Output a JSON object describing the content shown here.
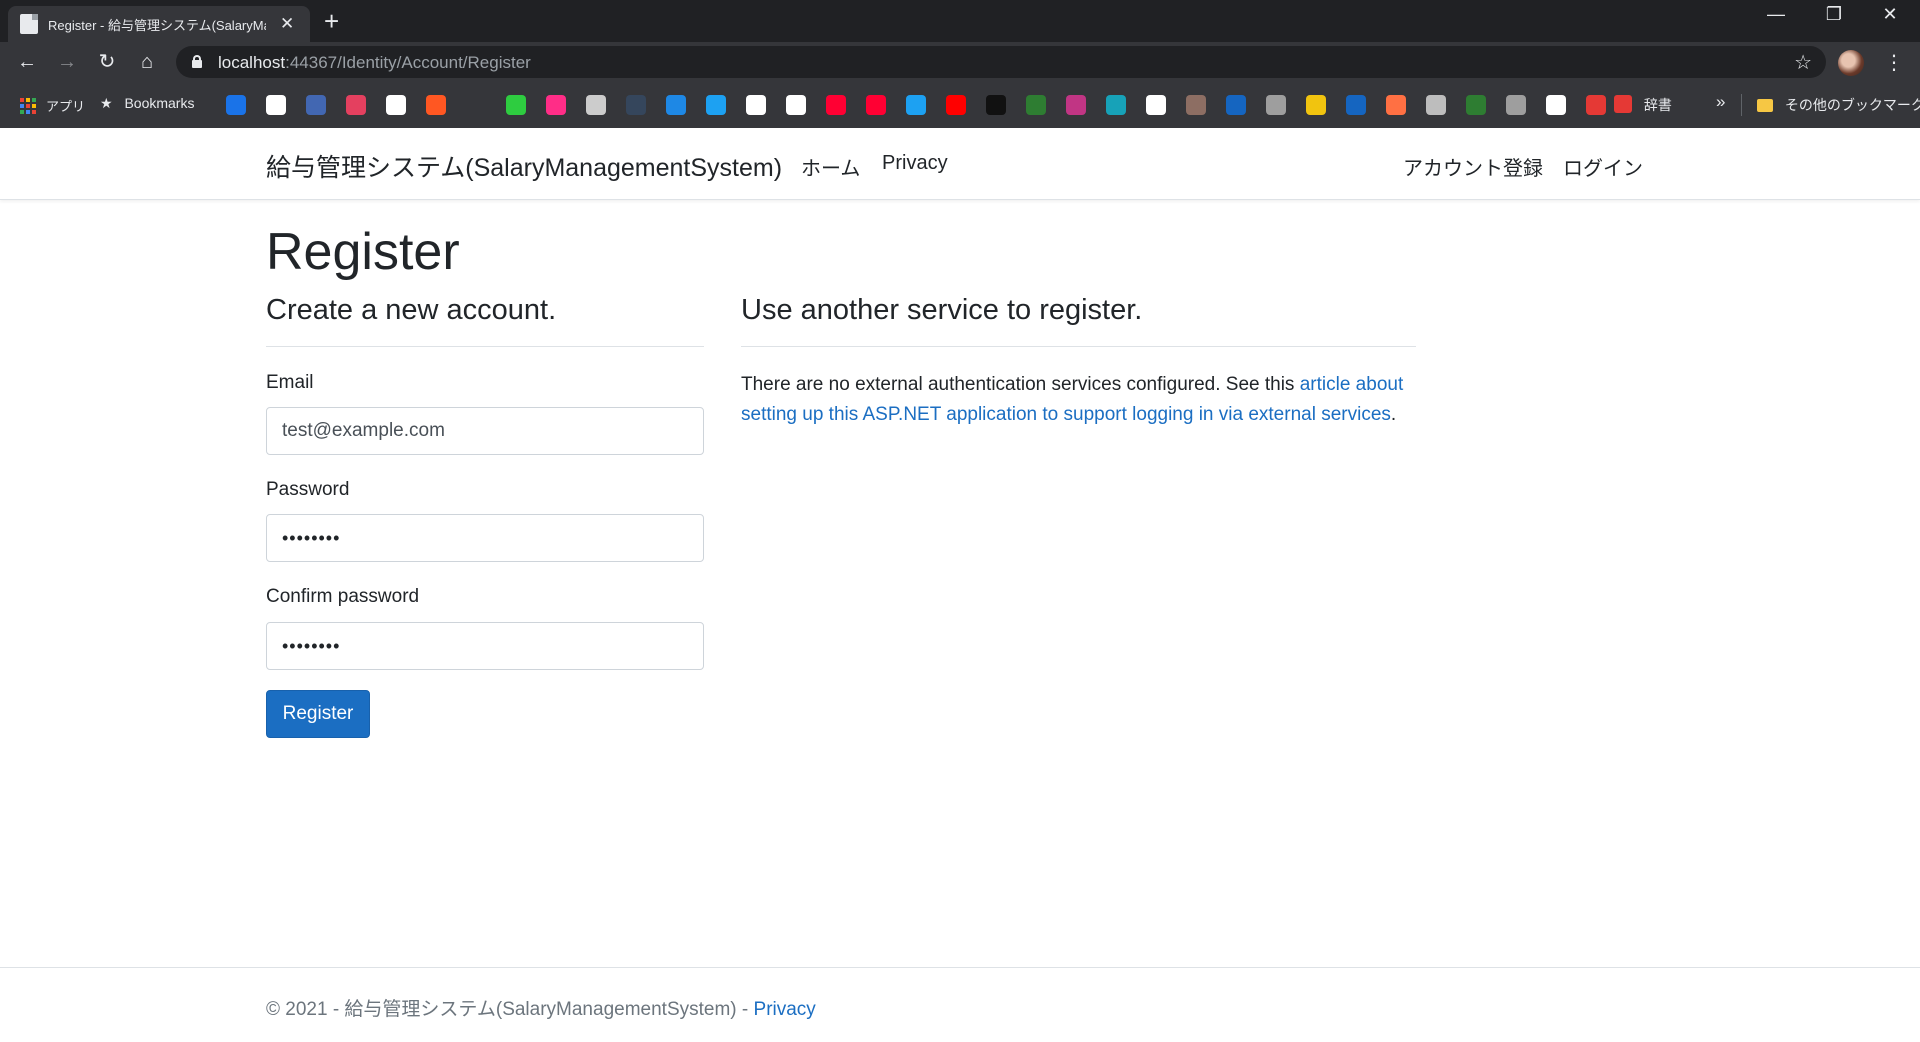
{
  "browser": {
    "tab_title": "Register - 給与管理システム(SalaryManagementSystem)",
    "url_host": "localhost",
    "url_path": ":44367/Identity/Account/Register",
    "bookmarks_bar": {
      "apps_label": "アプリ",
      "bookmarks_label": "Bookmarks",
      "dictionary_label": "辞書",
      "overflow_label": "»",
      "other_bookmarks_label": "その他のブックマーク",
      "icon_colors": [
        "#1a73e8",
        "#ffffff",
        "#4267b2",
        "#e4405f",
        "#ffffff",
        "#ff5722",
        "#2ecc40",
        "#ff2d87",
        "#cccccc",
        "#35465c",
        "#1e88e5",
        "#1da1f2",
        "#ffffff",
        "#ffffff",
        "#ff0033",
        "#ff0033",
        "#1da1f2",
        "#ff0000",
        "#111111",
        "#2e7d32",
        "#c13584",
        "#17a2b8",
        "#ffffff",
        "#8d6e63",
        "#1565c0",
        "#9e9e9e",
        "#f1c40f",
        "#1565c0",
        "#ff7043",
        "#bdbdbd",
        "#2e7d32",
        "#9e9e9e",
        "#ffffff",
        "#e53935"
      ]
    }
  },
  "site": {
    "brand": "給与管理システム(SalaryManagementSystem)",
    "nav": {
      "home": "ホーム",
      "privacy": "Privacy"
    },
    "account": {
      "register": "アカウント登録",
      "login": "ログイン"
    }
  },
  "page": {
    "title": "Register",
    "create_heading": "Create a new account.",
    "external_heading": "Use another service to register.",
    "form": {
      "email_label": "Email",
      "email_value": "test@example.com",
      "password_label": "Password",
      "password_value": "••••••••",
      "confirm_label": "Confirm password",
      "confirm_value": "••••••••",
      "submit_label": "Register"
    },
    "external": {
      "text_prefix": "There are no external authentication services configured. See this ",
      "link_text": "article about setting up this ASP.NET application to support logging in via external services",
      "text_suffix": "."
    }
  },
  "footer": {
    "copyright": "© 2021 - 給与管理システム(SalaryManagementSystem) - ",
    "privacy_link": "Privacy"
  },
  "colors": {
    "primary": "#1b6ec2",
    "chrome_dark": "#202124",
    "chrome_toolbar": "#35363a"
  }
}
